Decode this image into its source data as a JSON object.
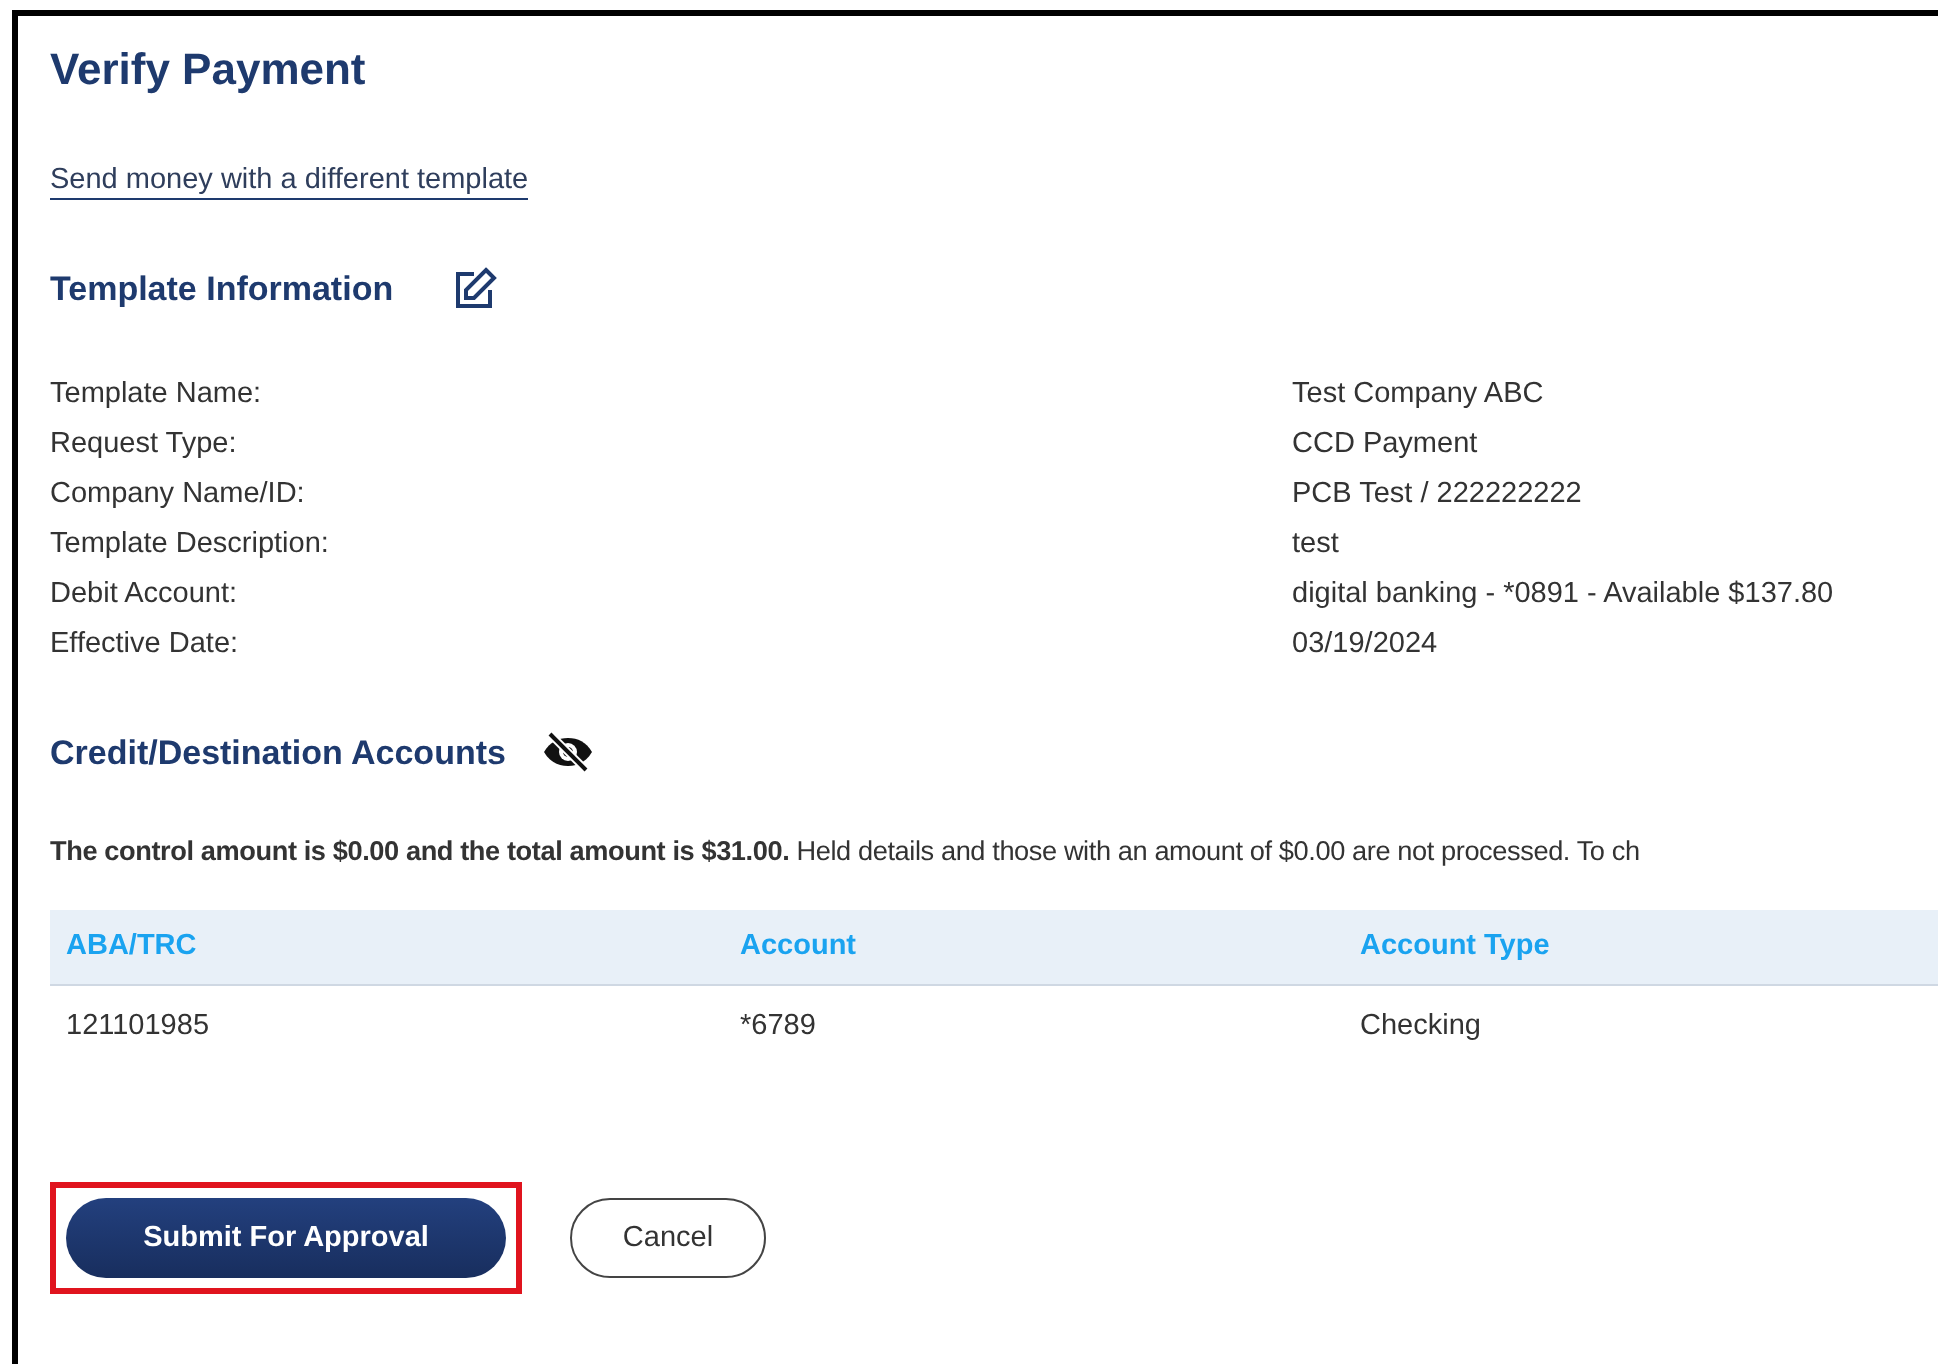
{
  "title": "Verify Payment",
  "template_link": "Send money with a different template",
  "template_info": {
    "heading": "Template Information",
    "fields": [
      {
        "label": "Template Name:",
        "value": "Test Company ABC"
      },
      {
        "label": "Request Type:",
        "value": "CCD Payment"
      },
      {
        "label": "Company Name/ID:",
        "value": "PCB Test / 222222222"
      },
      {
        "label": "Template Description:",
        "value": "test"
      },
      {
        "label": "Debit Account:",
        "value": "digital banking - *0891 - Available $137.80"
      },
      {
        "label": "Effective Date:",
        "value": "03/19/2024"
      }
    ]
  },
  "credit_section": {
    "heading": "Credit/Destination Accounts",
    "note": "**The control amount is $0.00 and the total amount is $31.00.** Held details and those with an amount of $0.00 are not processed. To ch"
  },
  "table": {
    "columns": [
      "ABA/TRC",
      "Account",
      "Account Type"
    ],
    "rows": [
      [
        "121101985",
        "*6789",
        "Checking"
      ]
    ]
  },
  "buttons": [
    {
      "label": "Submit For Approval",
      "kind": "primary",
      "highlighted": true
    },
    {
      "label": "Cancel",
      "kind": "secondary",
      "highlighted": false
    }
  ]
}
